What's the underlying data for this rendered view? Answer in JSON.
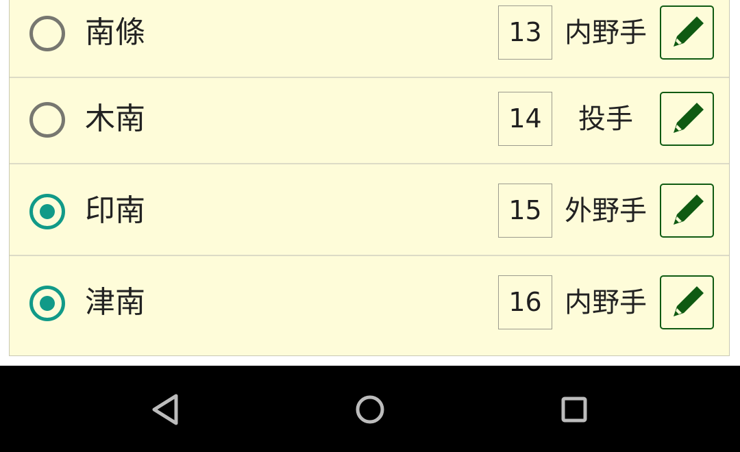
{
  "rows": [
    {
      "name": "南條",
      "number": "13",
      "position": "内野手",
      "selected": false
    },
    {
      "name": "木南",
      "number": "14",
      "position": "投手",
      "selected": false
    },
    {
      "name": "印南",
      "number": "15",
      "position": "外野手",
      "selected": true
    },
    {
      "name": "津南",
      "number": "16",
      "position": "内野手",
      "selected": true
    }
  ],
  "icons": {
    "edit": "pencil-icon",
    "nav_back": "back-triangle-icon",
    "nav_home": "home-circle-icon",
    "nav_recents": "recents-square-icon"
  },
  "colors": {
    "row_background": "#fefcd9",
    "radio_selected": "#119a88",
    "radio_unselected": "#777770",
    "edit_icon": "#0f5a12",
    "nav_bar": "#000000"
  }
}
